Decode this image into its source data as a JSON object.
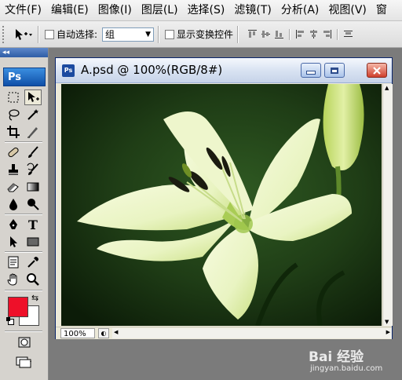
{
  "menu": [
    "文件(F)",
    "编辑(E)",
    "图像(I)",
    "图层(L)",
    "选择(S)",
    "滤镜(T)",
    "分析(A)",
    "视图(V)",
    "窗"
  ],
  "options": {
    "auto_select_label": "自动选择:",
    "auto_select_value": "组",
    "show_transform_label": "显示变换控件"
  },
  "toolbox": {
    "logo": "Ps",
    "collapse": "◂◂",
    "foreground_color": "#ee1029",
    "background_color": "#ffffff"
  },
  "document": {
    "title": "A.psd @ 100%(RGB/8#)",
    "zoom": "100%",
    "icon_text": "Ps"
  },
  "watermark": {
    "brand": "Bai 经验",
    "url": "jingyan.baidu.com"
  }
}
